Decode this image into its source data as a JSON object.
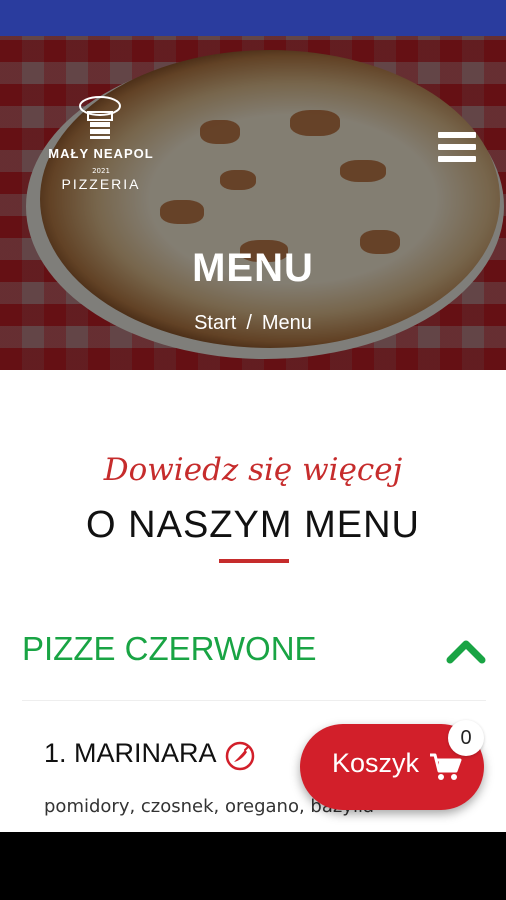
{
  "header": {
    "title": "MENU",
    "breadcrumb": {
      "home": "Start",
      "separator": "/",
      "current": "Menu"
    }
  },
  "logo": {
    "name": "MAŁY NEAPOL",
    "year": "2021",
    "subtitle": "PIZZERIA"
  },
  "intro": {
    "tagline": "Dowiedz się więcej",
    "title": "O NASZYM MENU"
  },
  "menu": {
    "category": {
      "name": "PIZZE CZERWONE",
      "expanded": true
    },
    "items": [
      {
        "name": "1. MARINARA",
        "spicy_icon": "chili-pepper-icon",
        "description": "pomidory, czosnek, oregano, bazylia"
      }
    ]
  },
  "cart": {
    "label": "Koszyk",
    "count": "0",
    "icon": "cart-icon"
  },
  "colors": {
    "accent_red": "#c62c2c",
    "category_green": "#19a444",
    "cart_red": "#d21f2a",
    "status_bar": "#2a3c9e"
  }
}
